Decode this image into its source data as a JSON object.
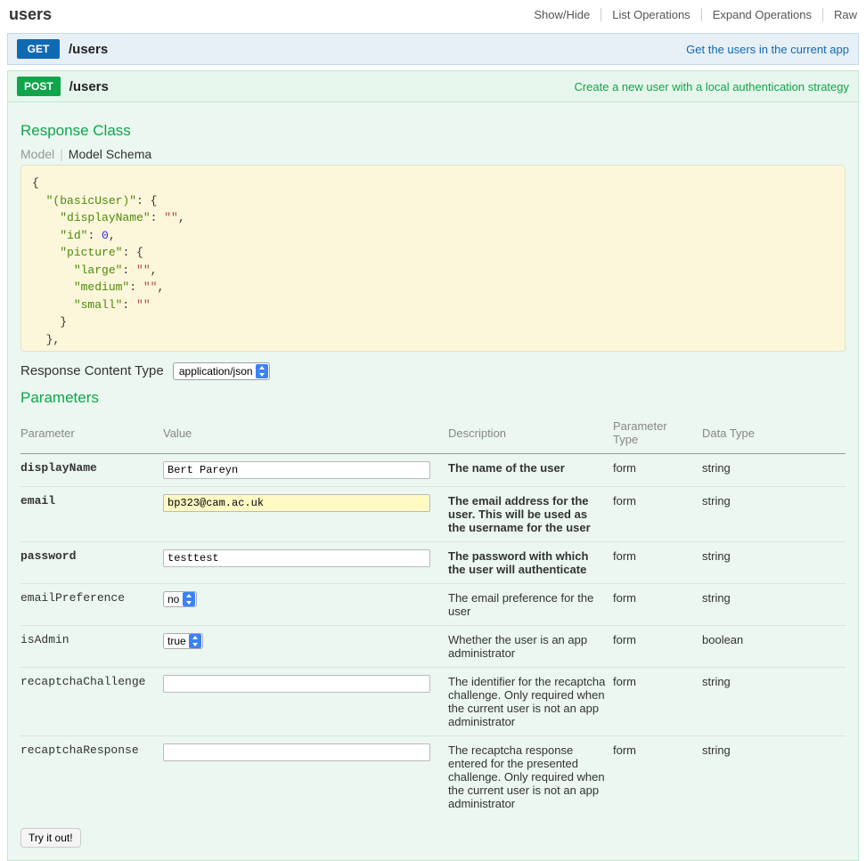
{
  "header": {
    "title": "users",
    "ops": [
      "Show/Hide",
      "List Operations",
      "Expand Operations",
      "Raw"
    ]
  },
  "operations": {
    "get": {
      "method": "GET",
      "path": "/users",
      "desc": "Get the users in the current app"
    },
    "post": {
      "method": "POST",
      "path": "/users",
      "desc": "Create a new user with a local authentication strategy"
    }
  },
  "response_class": {
    "title": "Response Class",
    "tabs": {
      "model": "Model",
      "schema": "Model Schema"
    },
    "content_type_label": "Response Content Type",
    "content_type_value": "application/json"
  },
  "model_schema_code": "{\n  \"(basicUser)\": {\n    \"displayName\": \"\",\n    \"id\": 0,\n    \"picture\": {\n      \"large\": \"\",\n      \"medium\": \"\",\n      \"small\": \"\"\n    }\n  },\n  \"(fullUser)\": {",
  "parameters": {
    "title": "Parameters",
    "headers": {
      "parameter": "Parameter",
      "value": "Value",
      "description": "Description",
      "ptype": "Parameter Type",
      "dtype": "Data Type"
    },
    "rows": [
      {
        "name": "displayName",
        "value": "Bert Pareyn",
        "input": "text",
        "desc": "The name of the user",
        "ptype": "form",
        "dtype": "string",
        "bold": true
      },
      {
        "name": "email",
        "value": "bp323@cam.ac.uk",
        "input": "text_highlight",
        "desc": "The email address for the user. This will be used as the username for the user",
        "ptype": "form",
        "dtype": "string",
        "bold": true
      },
      {
        "name": "password",
        "value": "testtest",
        "input": "text",
        "desc": "The password with which the user will authenticate",
        "ptype": "form",
        "dtype": "string",
        "bold": true
      },
      {
        "name": "emailPreference",
        "value": "no",
        "input": "select",
        "desc": "The email preference for the user",
        "ptype": "form",
        "dtype": "string",
        "bold": false
      },
      {
        "name": "isAdmin",
        "value": "true",
        "input": "select",
        "desc": "Whether the user is an app administrator",
        "ptype": "form",
        "dtype": "boolean",
        "bold": false
      },
      {
        "name": "recaptchaChallenge",
        "value": "",
        "input": "text",
        "desc": "The identifier for the recaptcha challenge. Only required when the current user is not an app administrator",
        "ptype": "form",
        "dtype": "string",
        "bold": false
      },
      {
        "name": "recaptchaResponse",
        "value": "",
        "input": "text",
        "desc": "The recaptcha response entered for the presented challenge. Only required when the current user is not an app administrator",
        "ptype": "form",
        "dtype": "string",
        "bold": false
      }
    ]
  },
  "try_button": "Try it out!"
}
